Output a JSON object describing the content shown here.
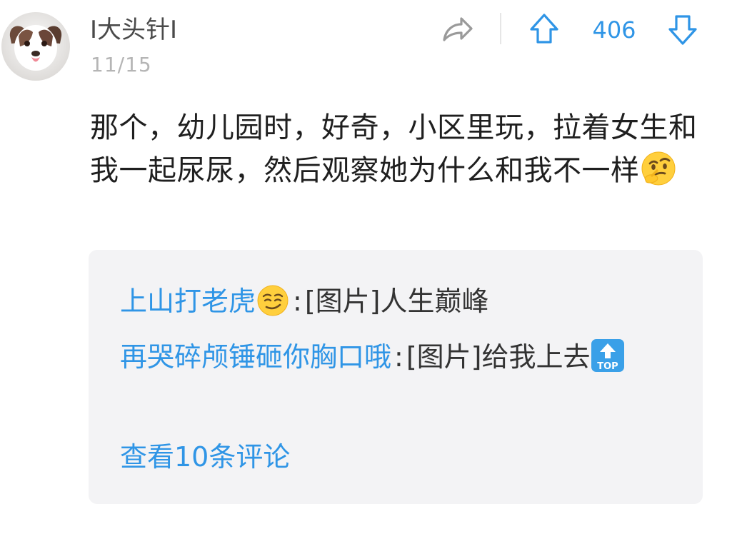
{
  "post": {
    "username": "I大头针I",
    "date": "11/15",
    "vote_count": "406",
    "content": "那个，幼儿园时，好奇，小区里玩，拉着女生和我一起尿尿，然后观察她为什么和我不一样",
    "content_emoji": "thinking-face-emoji"
  },
  "icons": {
    "share": "share-icon",
    "upvote": "arrow-up-icon",
    "downvote": "arrow-down-icon"
  },
  "replies": [
    {
      "user": "上山打老虎",
      "user_emoji": "smirking-face-emoji",
      "colon": ":",
      "text": "[图片]人生巅峰"
    },
    {
      "user": "再哭碎颅锤砸你胸口哦",
      "colon": ":",
      "text": "[图片]给我上去",
      "text_emoji": "top-arrow-emoji"
    }
  ],
  "view_more": "查看10条评论",
  "colors": {
    "accent": "#2f95e6",
    "username": "#4a4a4a",
    "timestamp": "#b5b5b5",
    "reply_bg": "#f3f3f5"
  }
}
